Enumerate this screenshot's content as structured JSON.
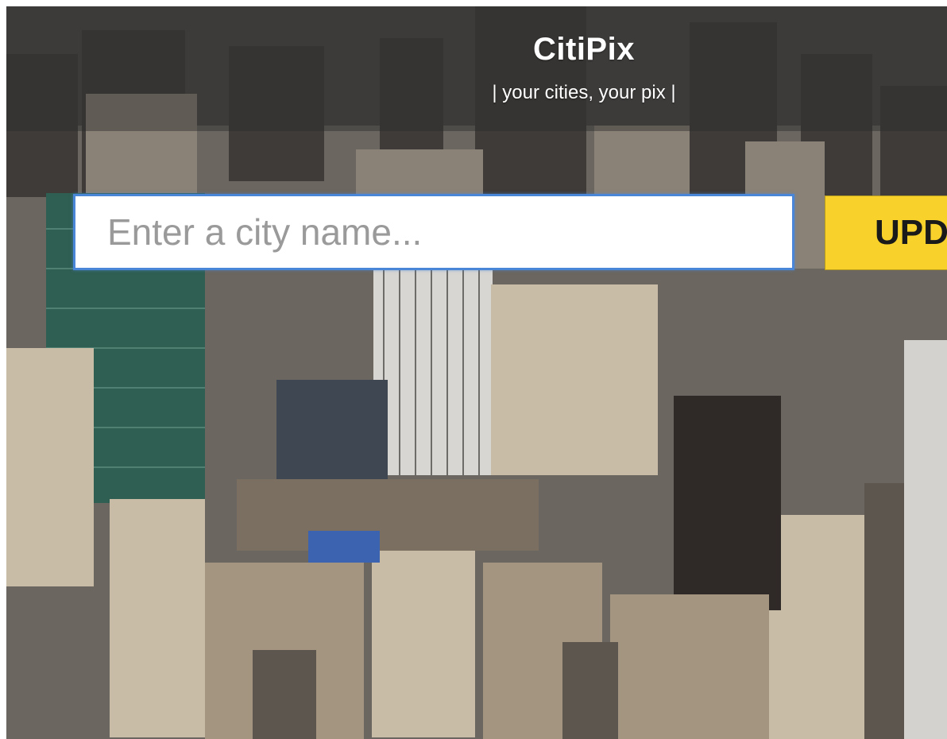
{
  "header": {
    "title": "CitiPix",
    "tagline": "| your cities, your pix |"
  },
  "search": {
    "placeholder": "Enter a city name...",
    "value": ""
  },
  "update_button": {
    "label": "UPDATE"
  },
  "colors": {
    "accent": "#f8d22a",
    "input_border": "#4a86d8",
    "header_overlay": "#2d2d2d"
  }
}
